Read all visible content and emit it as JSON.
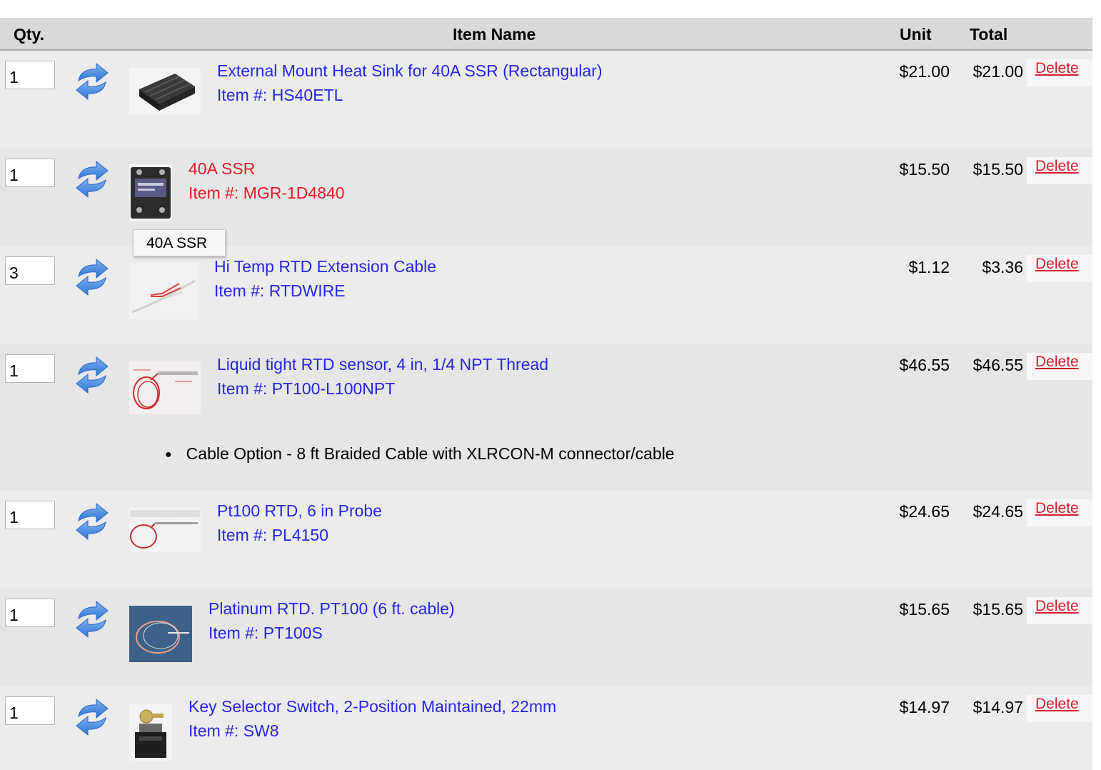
{
  "header": {
    "qty": "Qty.",
    "item_name": "Item Name",
    "unit": "Unit",
    "total": "Total"
  },
  "items": [
    {
      "qty": "1",
      "title": "External Mount Heat Sink for 40A SSR (Rectangular)",
      "sku": "Item #: HS40ETL",
      "unit": "$21.00",
      "total": "$21.00",
      "delete": "Delete",
      "link_color": "#2626e8"
    },
    {
      "qty": "1",
      "title": "40A SSR",
      "sku": "Item #: MGR-1D4840",
      "unit": "$15.50",
      "total": "$15.50",
      "delete": "Delete",
      "link_color": "#ee1b24"
    },
    {
      "qty": "3",
      "title": "Hi Temp RTD Extension Cable",
      "sku": "Item #: RTDWIRE",
      "unit": "$1.12",
      "total": "$3.36",
      "delete": "Delete",
      "link_color": "#2626e8"
    },
    {
      "qty": "1",
      "title": "Liquid tight RTD sensor, 4 in, 1/4 NPT Thread",
      "sku": "Item #: PT100-L100NPT",
      "unit": "$46.55",
      "total": "$46.55",
      "delete": "Delete",
      "option": "Cable Option - 8 ft Braided Cable with XLRCON-M connector/cable",
      "link_color": "#2626e8"
    },
    {
      "qty": "1",
      "title": "Pt100 RTD, 6 in Probe",
      "sku": "Item #: PL4150",
      "unit": "$24.65",
      "total": "$24.65",
      "delete": "Delete",
      "link_color": "#2626e8"
    },
    {
      "qty": "1",
      "title": "Platinum RTD. PT100 (6 ft. cable)",
      "sku": "Item #: PT100S",
      "unit": "$15.65",
      "total": "$15.65",
      "delete": "Delete",
      "link_color": "#2626e8"
    },
    {
      "qty": "1",
      "title": "Key Selector Switch, 2-Position Maintained, 22mm",
      "sku": "Item #: SW8",
      "unit": "$14.97",
      "total": "$14.97",
      "delete": "Delete",
      "link_color": "#2626e8"
    }
  ],
  "tooltip": "40A SSR",
  "icons": {
    "update": "refresh-arrows-icon",
    "bullet": "bullet-icon"
  },
  "colors": {
    "link": "#2626e8",
    "hover_link": "#ee1b24",
    "delete": "#d81d2c",
    "header_bg": "#d9d9d9"
  }
}
